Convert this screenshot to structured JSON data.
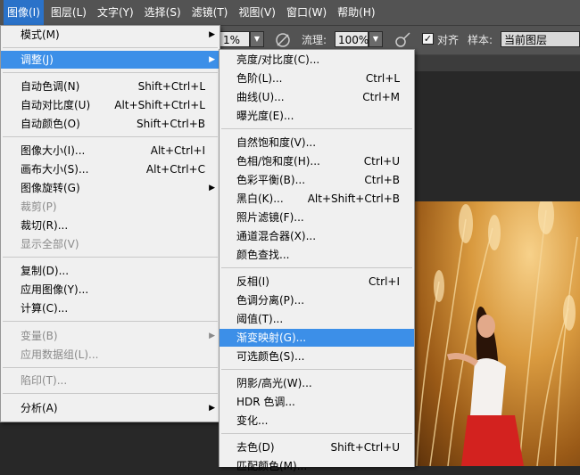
{
  "menubar": [
    "图像(I)",
    "图层(L)",
    "文字(Y)",
    "选择(S)",
    "滤镜(T)",
    "视图(V)",
    "窗口(W)",
    "帮助(H)"
  ],
  "optbar": {
    "opacity_partial": "1%",
    "flow_label": "流理:",
    "flow_value": "100%",
    "align_label": "对齐",
    "sample_label": "样本:",
    "sample_value": "当前图层"
  },
  "image_menu": [
    {
      "label": "模式(M)",
      "shortcut": "",
      "submenu": true
    },
    {
      "label": "调整(J)",
      "shortcut": "",
      "submenu": true,
      "highlight": true
    },
    {
      "label": "自动色调(N)",
      "shortcut": "Shift+Ctrl+L"
    },
    {
      "label": "自动对比度(U)",
      "shortcut": "Alt+Shift+Ctrl+L"
    },
    {
      "label": "自动颜色(O)",
      "shortcut": "Shift+Ctrl+B"
    },
    {
      "label": "图像大小(I)...",
      "shortcut": "Alt+Ctrl+I"
    },
    {
      "label": "画布大小(S)...",
      "shortcut": "Alt+Ctrl+C"
    },
    {
      "label": "图像旋转(G)",
      "shortcut": "",
      "submenu": true
    },
    {
      "label": "裁剪(P)",
      "shortcut": "",
      "disabled": true
    },
    {
      "label": "裁切(R)...",
      "shortcut": ""
    },
    {
      "label": "显示全部(V)",
      "shortcut": "",
      "disabled": true
    },
    {
      "label": "复制(D)...",
      "shortcut": ""
    },
    {
      "label": "应用图像(Y)...",
      "shortcut": ""
    },
    {
      "label": "计算(C)...",
      "shortcut": ""
    },
    {
      "label": "变量(B)",
      "shortcut": "",
      "disabled": true,
      "submenu": true
    },
    {
      "label": "应用数据组(L)...",
      "shortcut": "",
      "disabled": true
    },
    {
      "label": "陷印(T)...",
      "shortcut": "",
      "disabled": true
    },
    {
      "label": "分析(A)",
      "shortcut": "",
      "submenu": true
    }
  ],
  "adjust_menu": [
    {
      "label": "亮度/对比度(C)...",
      "shortcut": ""
    },
    {
      "label": "色阶(L)...",
      "shortcut": "Ctrl+L"
    },
    {
      "label": "曲线(U)...",
      "shortcut": "Ctrl+M"
    },
    {
      "label": "曝光度(E)...",
      "shortcut": ""
    },
    {
      "label": "自然饱和度(V)...",
      "shortcut": ""
    },
    {
      "label": "色相/饱和度(H)...",
      "shortcut": "Ctrl+U"
    },
    {
      "label": "色彩平衡(B)...",
      "shortcut": "Ctrl+B"
    },
    {
      "label": "黑白(K)...",
      "shortcut": "Alt+Shift+Ctrl+B"
    },
    {
      "label": "照片滤镜(F)...",
      "shortcut": ""
    },
    {
      "label": "通道混合器(X)...",
      "shortcut": ""
    },
    {
      "label": "颜色查找...",
      "shortcut": ""
    },
    {
      "label": "反相(I)",
      "shortcut": "Ctrl+I"
    },
    {
      "label": "色调分离(P)...",
      "shortcut": ""
    },
    {
      "label": "阈值(T)...",
      "shortcut": ""
    },
    {
      "label": "渐变映射(G)...",
      "shortcut": "",
      "highlight": true
    },
    {
      "label": "可选颜色(S)...",
      "shortcut": ""
    },
    {
      "label": "阴影/高光(W)...",
      "shortcut": ""
    },
    {
      "label": "HDR 色调...",
      "shortcut": ""
    },
    {
      "label": "变化...",
      "shortcut": ""
    },
    {
      "label": "去色(D)",
      "shortcut": "Shift+Ctrl+U"
    },
    {
      "label": "匹配颜色(M)...",
      "shortcut": ""
    }
  ]
}
